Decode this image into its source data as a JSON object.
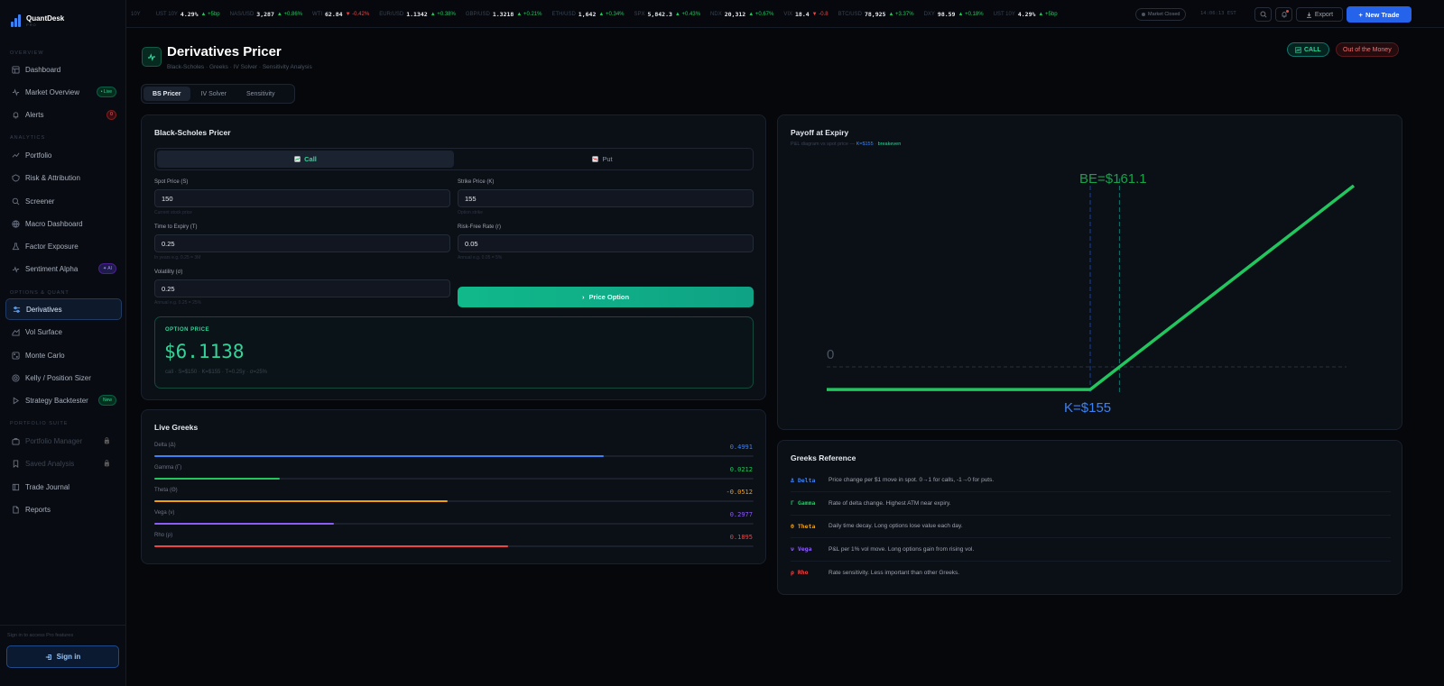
{
  "brand": {
    "name": "QuantDesk",
    "sub": "PRO"
  },
  "sidebar": {
    "sections": {
      "overview": "OVERVIEW",
      "analytics": "ANALYTICS",
      "options": "OPTIONS & QUANT",
      "suite": "PORTFOLIO SUITE"
    },
    "items": [
      {
        "label": "Dashboard",
        "icon": "grid-icon"
      },
      {
        "label": "Market Overview",
        "icon": "activity-icon",
        "badge": "• Live"
      },
      {
        "label": "Alerts",
        "icon": "bell-icon",
        "badge": "0"
      },
      {
        "label": "Portfolio",
        "icon": "trend-icon"
      },
      {
        "label": "Risk & Attribution",
        "icon": "shield-icon"
      },
      {
        "label": "Screener",
        "icon": "search-icon"
      },
      {
        "label": "Macro Dashboard",
        "icon": "globe-icon"
      },
      {
        "label": "Factor Exposure",
        "icon": "flask-icon"
      },
      {
        "label": "Sentiment Alpha",
        "icon": "pulse-icon",
        "badge": "✦ AI"
      },
      {
        "label": "Derivatives",
        "icon": "sliders-icon"
      },
      {
        "label": "Vol Surface",
        "icon": "surface-icon"
      },
      {
        "label": "Monte Carlo",
        "icon": "dice-icon"
      },
      {
        "label": "Kelly / Position Sizer",
        "icon": "target-icon"
      },
      {
        "label": "Strategy Backtester",
        "icon": "play-icon",
        "badge": "New"
      },
      {
        "label": "Portfolio Manager",
        "icon": "briefcase-icon"
      },
      {
        "label": "Saved Analysis",
        "icon": "bookmark-icon"
      },
      {
        "label": "Trade Journal",
        "icon": "book-icon"
      },
      {
        "label": "Reports",
        "icon": "file-icon"
      }
    ],
    "signin_note": "Sign in to access Pro features",
    "signin_label": "Sign in"
  },
  "ticker": [
    {
      "sym": "10Y",
      "price": "",
      "chg": "",
      "dir": ""
    },
    {
      "sym": "UST 10Y",
      "price": "4.29%",
      "chg": "▲ +5bp",
      "dir": "up"
    },
    {
      "sym": "NAS/USD",
      "price": "3,287",
      "chg": "▲ +0.86%",
      "dir": "up"
    },
    {
      "sym": "WTI",
      "price": "62.84",
      "chg": "▼ -0.42%",
      "dir": "dn"
    },
    {
      "sym": "EUR/USD",
      "price": "1.1342",
      "chg": "▲ +0.38%",
      "dir": "up"
    },
    {
      "sym": "GBP/USD",
      "price": "1.3218",
      "chg": "▲ +0.21%",
      "dir": "up"
    },
    {
      "sym": "ETH/USD",
      "price": "1,642",
      "chg": "▲ +0.34%",
      "dir": "up"
    },
    {
      "sym": "SPX",
      "price": "5,842.3",
      "chg": "▲ +0.43%",
      "dir": "up"
    },
    {
      "sym": "NDX",
      "price": "20,312",
      "chg": "▲ +0.67%",
      "dir": "up"
    },
    {
      "sym": "VIX",
      "price": "18.4",
      "chg": "▼ -0.8",
      "dir": "dn"
    },
    {
      "sym": "BTC/USD",
      "price": "78,925",
      "chg": "▲ +3.37%",
      "dir": "up"
    },
    {
      "sym": "DXY",
      "price": "98.59",
      "chg": "▲ +0.18%",
      "dir": "up"
    },
    {
      "sym": "UST 10Y",
      "price": "4.29%",
      "chg": "▲ +5bp",
      "dir": "up"
    }
  ],
  "topbar": {
    "market_status": "Market Closed",
    "clock": "14:06:13 EST",
    "export_label": "Export",
    "new_trade_label": "New Trade"
  },
  "page": {
    "title": "Derivatives Pricer",
    "subtitle": "Black-Scholes · Greeks · IV Solver · Sensitivity Analysis",
    "pill_call": "CALL",
    "pill_money": "Out of the Money",
    "tabs": [
      "BS Pricer",
      "IV Solver",
      "Sensitivity"
    ]
  },
  "pricer": {
    "title": "Black-Scholes Pricer",
    "call_label": "Call",
    "put_label": "Put",
    "fields": {
      "spot": {
        "label": "Spot Price (S)",
        "value": "150",
        "hint": "Current stock price"
      },
      "strike": {
        "label": "Strike Price (K)",
        "value": "155",
        "hint": "Option strike"
      },
      "expiry": {
        "label": "Time to Expiry (T)",
        "value": "0.25",
        "hint": "In years e.g. 0.25 = 3M"
      },
      "rate": {
        "label": "Risk-Free Rate (r)",
        "value": "0.05",
        "hint": "Annual e.g. 0.05 = 5%"
      },
      "vol": {
        "label": "Volatility (σ)",
        "value": "0.25",
        "hint": "Annual e.g. 0.25 = 25%"
      }
    },
    "button_label": "Price Option",
    "result_label": "OPTION PRICE",
    "result_value": "$6.1138",
    "result_sub": "call · S=$150 · K=$155 · T=0.25y · σ=25%"
  },
  "greeks": {
    "title": "Live Greeks",
    "rows": [
      {
        "label": "Delta (Δ)",
        "value": "0.4991",
        "fill": 0.75,
        "color": "#3b82f6"
      },
      {
        "label": "Gamma (Γ)",
        "value": "0.0212",
        "fill": 0.21,
        "color": "#22c55e"
      },
      {
        "label": "Theta (Θ)",
        "value": "-0.0512",
        "fill": 0.49,
        "color": "#f59e0b"
      },
      {
        "label": "Vega (ν)",
        "value": "0.2977",
        "fill": 0.3,
        "color": "#8b5cf6"
      },
      {
        "label": "Rho (ρ)",
        "value": "0.1895",
        "fill": 0.59,
        "color": "#ef4444"
      }
    ]
  },
  "payoff": {
    "title": "Payoff at Expiry",
    "sub_prefix": "P&L diagram vs spot price —",
    "sub_k": "K=$155",
    "sub_be": "breakeven",
    "strike_label": "K=$155",
    "be_label": "BE=$161.1",
    "zero_label": "0"
  },
  "chart_data": {
    "type": "line",
    "x": [
      100,
      155,
      210
    ],
    "y": [
      -6.11,
      -6.11,
      48.89
    ],
    "series": [
      {
        "values": [
          -6.11,
          -6.11,
          48.89
        ],
        "color": "#22c55e"
      }
    ],
    "annotations": [
      "K=$155",
      "BE=$161.1",
      "0"
    ],
    "strike": 155,
    "breakeven": 161.1
  },
  "reference": {
    "title": "Greeks Reference",
    "rows": [
      {
        "sym": "Δ Delta",
        "desc": "Price change per $1 move in spot. 0→1 for calls, -1→0 for puts.",
        "color": "#3b82f6"
      },
      {
        "sym": "Γ Gamma",
        "desc": "Rate of delta change. Highest ATM near expiry.",
        "color": "#22c55e"
      },
      {
        "sym": "Θ Theta",
        "desc": "Daily time decay. Long options lose value each day.",
        "color": "#f59e0b"
      },
      {
        "sym": "ν Vega",
        "desc": "P&L per 1% vol move. Long options gain from rising vol.",
        "color": "#8b5cf6"
      },
      {
        "sym": "ρ Rho",
        "desc": "Rate sensitivity. Less important than other Greeks.",
        "color": "#ef4444"
      }
    ]
  }
}
